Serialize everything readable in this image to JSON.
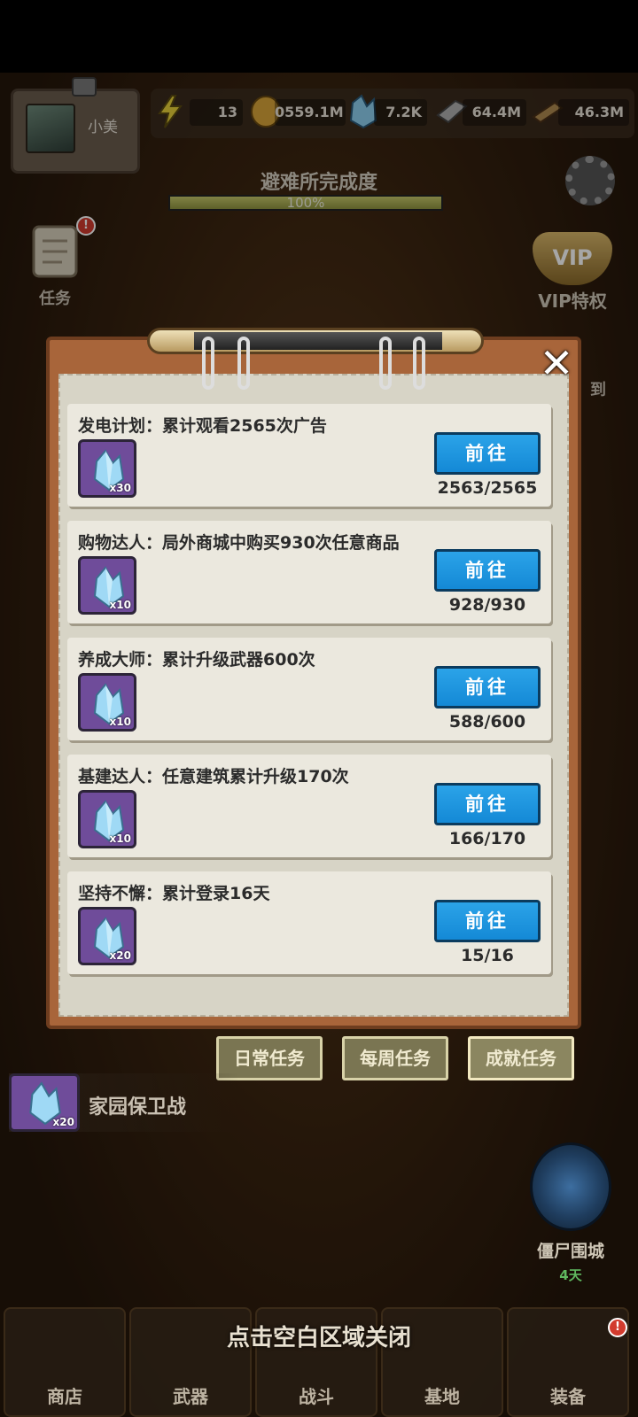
{
  "player": {
    "name": "小美"
  },
  "resources": {
    "energy": "13",
    "coins": "0559.1M",
    "crystals": "7.2K",
    "steel": "64.4M",
    "wood": "46.3M"
  },
  "shelter": {
    "title": "避难所完成度",
    "progress_text": "100%",
    "progress_value": 100
  },
  "side": {
    "tasks_label": "任务",
    "tasks_badge": "!",
    "vip_label": "VIP特权",
    "vip_shield": "VIP",
    "partial_label": "到"
  },
  "panel": {
    "close_symbol": "✕",
    "tasks": [
      {
        "title": "发电计划：累计观看2565次广告",
        "reward": "x30",
        "button": "前往",
        "progress": "2563/2565"
      },
      {
        "title": "购物达人：局外商城中购买930次任意商品",
        "reward": "x10",
        "button": "前往",
        "progress": "928/930"
      },
      {
        "title": "养成大师：累计升级武器600次",
        "reward": "x10",
        "button": "前往",
        "progress": "588/600"
      },
      {
        "title": "基建达人：任意建筑累计升级170次",
        "reward": "x10",
        "button": "前往",
        "progress": "166/170"
      },
      {
        "title": "坚持不懈：累计登录16天",
        "reward": "x20",
        "button": "前往",
        "progress": "15/16"
      }
    ],
    "tabs": [
      "日常任务",
      "每周任务",
      "成就任务"
    ],
    "active_tab": "成就任务"
  },
  "event": {
    "label": "家园保卫战",
    "reward": "x20"
  },
  "zombie_city": {
    "label": "僵尸围城",
    "days": "4天"
  },
  "close_hint": "点击空白区域关闭",
  "nav": [
    {
      "label": "商店",
      "badge": ""
    },
    {
      "label": "武器",
      "badge": ""
    },
    {
      "label": "战斗",
      "badge": ""
    },
    {
      "label": "基地",
      "badge": ""
    },
    {
      "label": "装备",
      "badge": "!"
    }
  ],
  "colors": {
    "go_button": "#1489d6",
    "reward_bg": "#6f4c9a",
    "panel_frame": "#a8653a"
  }
}
